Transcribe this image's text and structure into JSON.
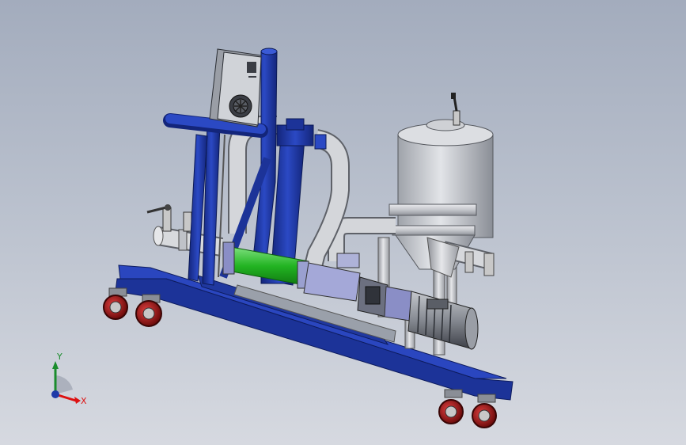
{
  "view": {
    "triad": {
      "x_label": "X",
      "y_label": "Y"
    },
    "colors": {
      "frame_blue": "#1f3aa8",
      "frame_blue_dark": "#13257a",
      "pipe_gray": "#c9cbd0",
      "tank_gray": "#bfc2c8",
      "stator_green": "#2bbd2b",
      "wheel_red": "#b01818",
      "motor_gray": "#7c8088"
    },
    "icons": [
      "coordinate-triad-icon",
      "ventilation-fan-icon",
      "ball-valve-icon"
    ]
  }
}
